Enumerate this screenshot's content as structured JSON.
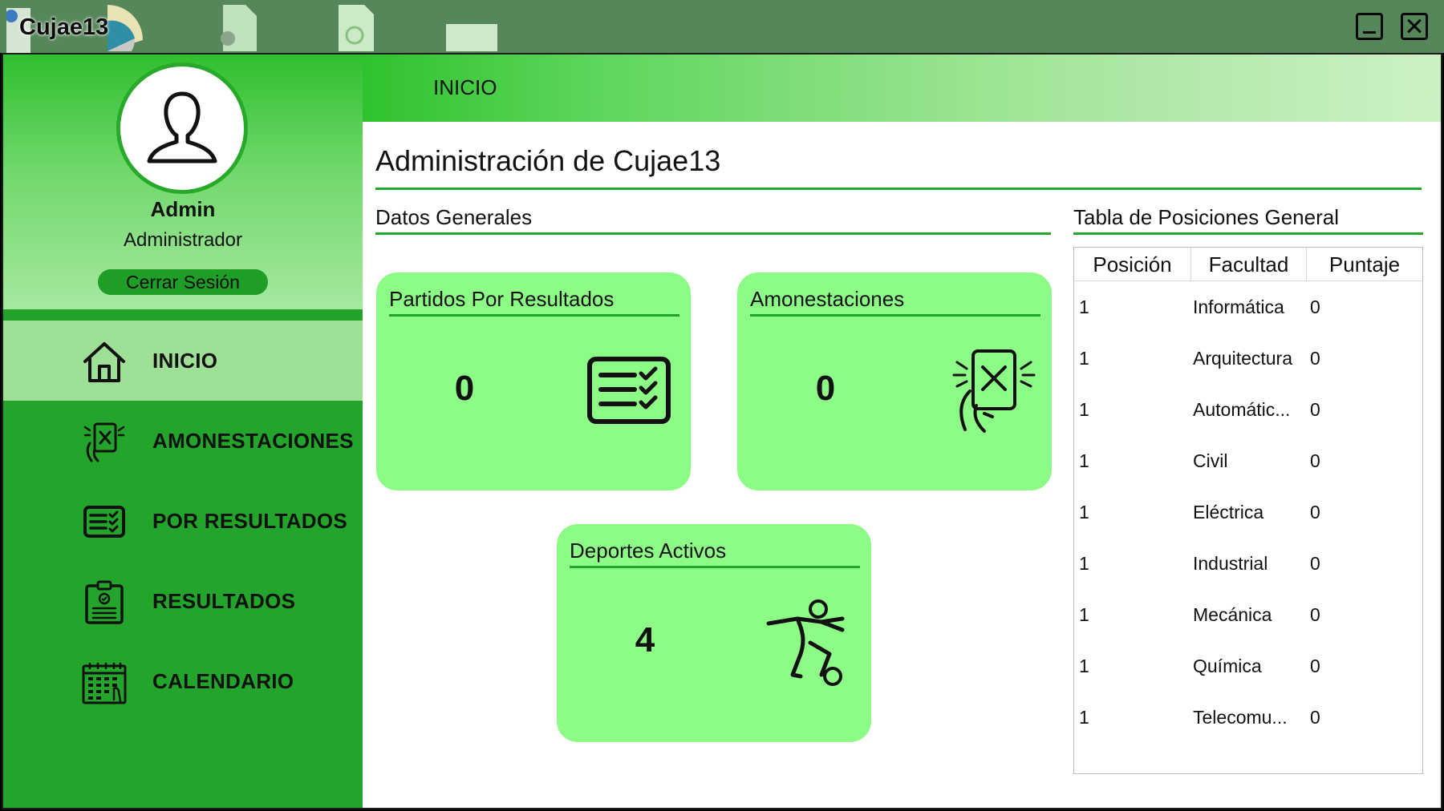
{
  "window": {
    "title": "Cujae13"
  },
  "profile": {
    "name": "Admin",
    "role": "Administrador",
    "logout_label": "Cerrar Sesión"
  },
  "sidebar": {
    "items": [
      {
        "label": "INICIO",
        "icon": "home-icon",
        "active": true
      },
      {
        "label": "AMONESTACIONES",
        "icon": "warning-card-icon",
        "active": false
      },
      {
        "label": "POR RESULTADOS",
        "icon": "checklist-icon",
        "active": false
      },
      {
        "label": "RESULTADOS",
        "icon": "clipboard-icon",
        "active": false
      },
      {
        "label": "CALENDARIO",
        "icon": "calendar-icon",
        "active": false
      }
    ]
  },
  "header": {
    "title": "INICIO"
  },
  "main": {
    "page_title": "Administración de Cujae13",
    "general_section_title": "Datos Generales",
    "standings_section_title": "Tabla de Posiciones General",
    "cards": [
      {
        "title": "Partidos Por Resultados",
        "value": "0",
        "icon": "checklist-icon"
      },
      {
        "title": "Amonestaciones",
        "value": "0",
        "icon": "warning-card-icon"
      },
      {
        "title": "Deportes Activos",
        "value": "4",
        "icon": "soccer-player-icon"
      }
    ]
  },
  "standings": {
    "columns": [
      "Posición",
      "Facultad",
      "Puntaje"
    ],
    "rows": [
      {
        "pos": "1",
        "facultad": "Informática",
        "puntaje": "0"
      },
      {
        "pos": "1",
        "facultad": "Arquitectura",
        "puntaje": "0"
      },
      {
        "pos": "1",
        "facultad": "Automátic...",
        "puntaje": "0"
      },
      {
        "pos": "1",
        "facultad": "Civil",
        "puntaje": "0"
      },
      {
        "pos": "1",
        "facultad": "Eléctrica",
        "puntaje": "0"
      },
      {
        "pos": "1",
        "facultad": "Industrial",
        "puntaje": "0"
      },
      {
        "pos": "1",
        "facultad": "Mecánica",
        "puntaje": "0"
      },
      {
        "pos": "1",
        "facultad": "Química",
        "puntaje": "0"
      },
      {
        "pos": "1",
        "facultad": "Telecomu...",
        "puntaje": "0"
      }
    ]
  },
  "colors": {
    "sidebar": "#22a52a",
    "card": "#8cfc86",
    "accent_rule": "#25a62b",
    "titlebar": "#56875a"
  }
}
